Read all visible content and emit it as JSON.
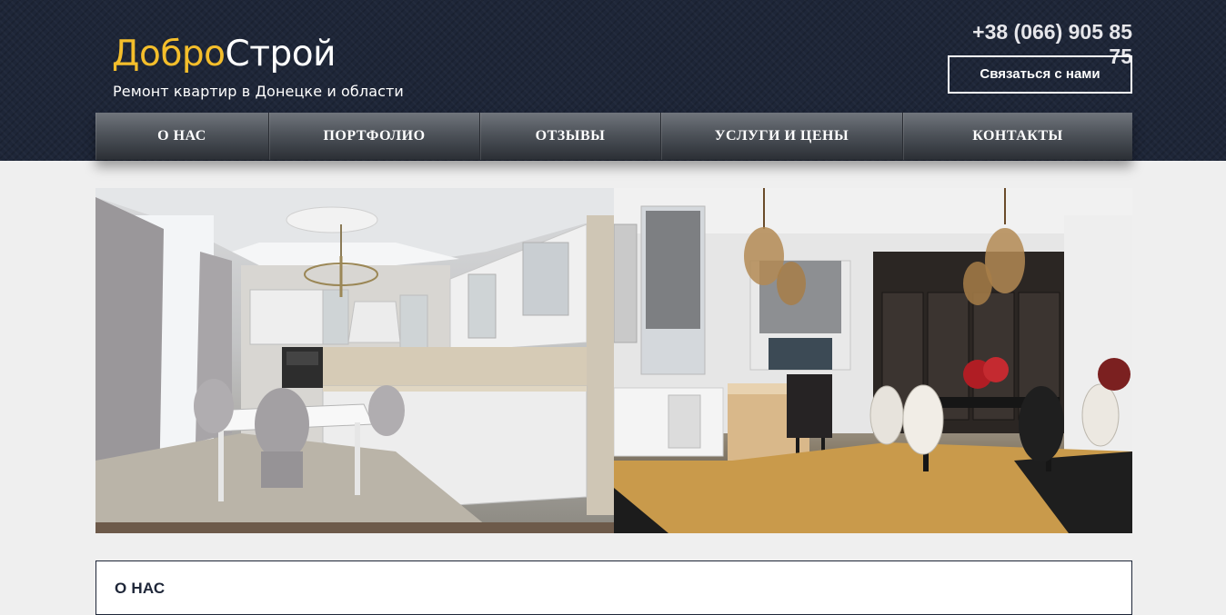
{
  "header": {
    "logo_part1": "Добро",
    "logo_part2": "Строй",
    "tagline": "Ремонт квартир в Донецке и области",
    "phone": "+38 (066) 905 85 75",
    "contact_button": "Связаться с нами"
  },
  "nav": {
    "items": [
      {
        "label": "О НАС"
      },
      {
        "label": "ПОРТФОЛИО"
      },
      {
        "label": "ОТЗЫВЫ"
      },
      {
        "label": "УСЛУГИ И ЦЕНЫ"
      },
      {
        "label": "КОНТАКТЫ"
      }
    ]
  },
  "about": {
    "title": "О НАС"
  },
  "colors": {
    "header_bg": "#1e2638",
    "logo_accent": "#f4be2b",
    "page_bg": "#efefef"
  }
}
